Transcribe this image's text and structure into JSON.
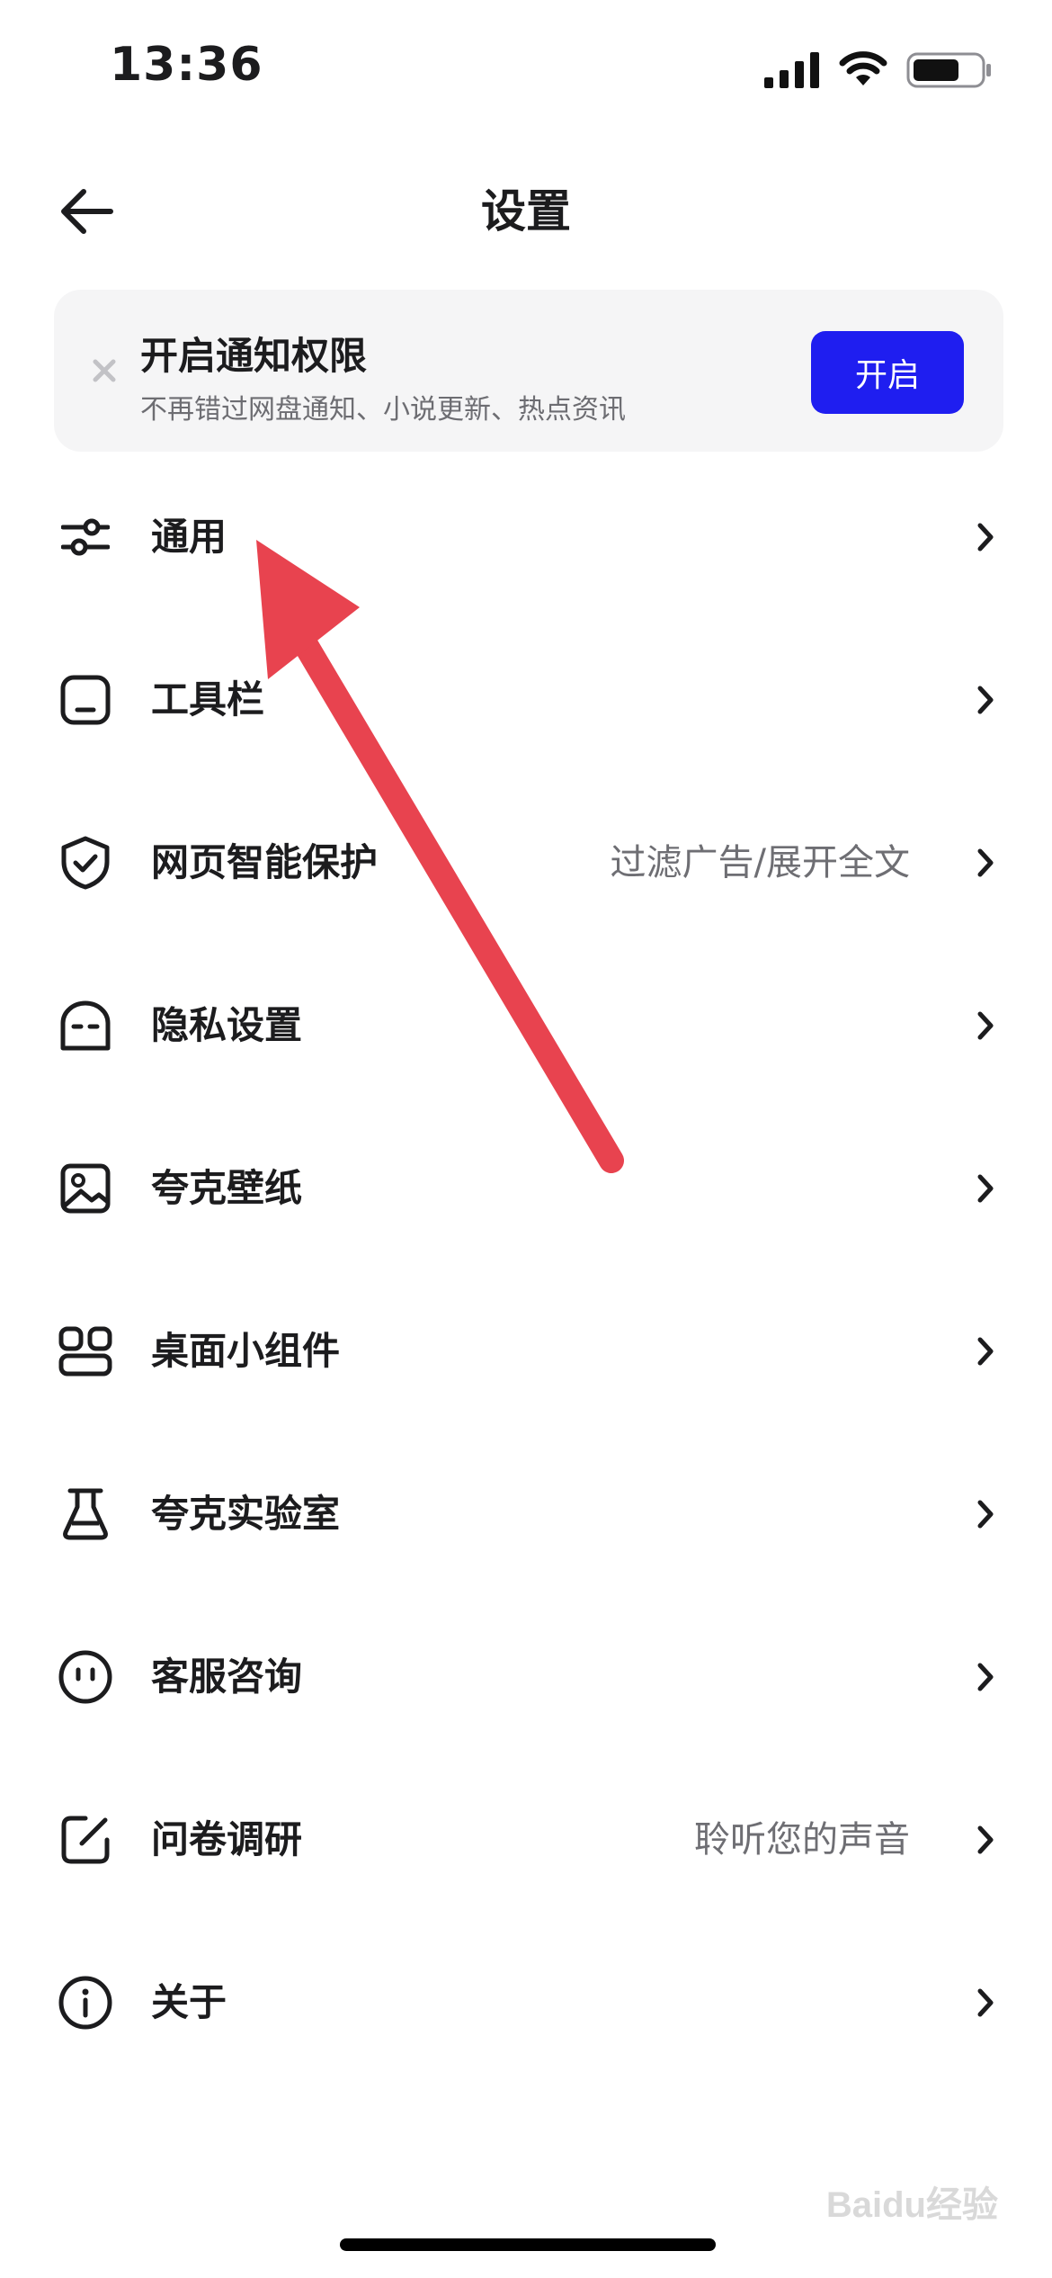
{
  "status_bar": {
    "time": "13:36"
  },
  "header": {
    "title": "设置"
  },
  "notification_banner": {
    "title": "开启通知权限",
    "description": "不再错过网盘通知、小说更新、热点资讯",
    "button_label": "开启"
  },
  "menu": {
    "items": [
      {
        "label": "通用",
        "value": "",
        "icon": "sliders-icon"
      },
      {
        "label": "工具栏",
        "value": "",
        "icon": "toolbar-icon"
      },
      {
        "label": "网页智能保护",
        "value": "过滤广告/展开全文",
        "icon": "shield-check-icon"
      },
      {
        "label": "隐私设置",
        "value": "",
        "icon": "privacy-mask-icon"
      },
      {
        "label": "夸克壁纸",
        "value": "",
        "icon": "image-icon"
      },
      {
        "label": "桌面小组件",
        "value": "",
        "icon": "widgets-icon"
      },
      {
        "label": "夸克实验室",
        "value": "",
        "icon": "flask-icon"
      },
      {
        "label": "客服咨询",
        "value": "",
        "icon": "face-icon"
      },
      {
        "label": "问卷调研",
        "value": "聆听您的声音",
        "icon": "edit-icon"
      },
      {
        "label": "关于",
        "value": "",
        "icon": "info-icon"
      }
    ]
  },
  "watermark": {
    "text": "Baidu经验"
  },
  "colors": {
    "accent": "#1f1ef0",
    "annotation_arrow": "#e8434f",
    "banner_bg": "#f5f5f6"
  }
}
